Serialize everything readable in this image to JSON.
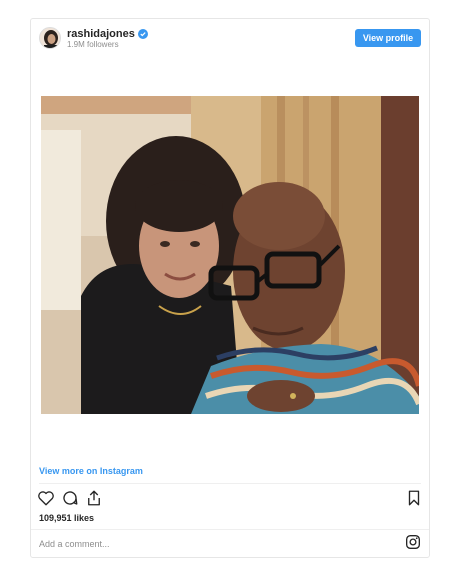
{
  "post": {
    "username": "rashidajones",
    "followers": "1.9M followers",
    "view_profile_label": "View profile",
    "view_more_label": "View more on Instagram",
    "likes": "109,951 likes",
    "comment_placeholder": "Add a comment..."
  },
  "icons": {
    "verified": "verified-badge-icon",
    "like": "heart-icon",
    "comment": "comment-icon",
    "share": "share-icon",
    "save": "bookmark-icon",
    "instagram": "instagram-logo-icon"
  },
  "colors": {
    "accent": "#3897f0",
    "text": "#262626",
    "muted": "#8e8e8e",
    "border": "#e6e6e6"
  }
}
